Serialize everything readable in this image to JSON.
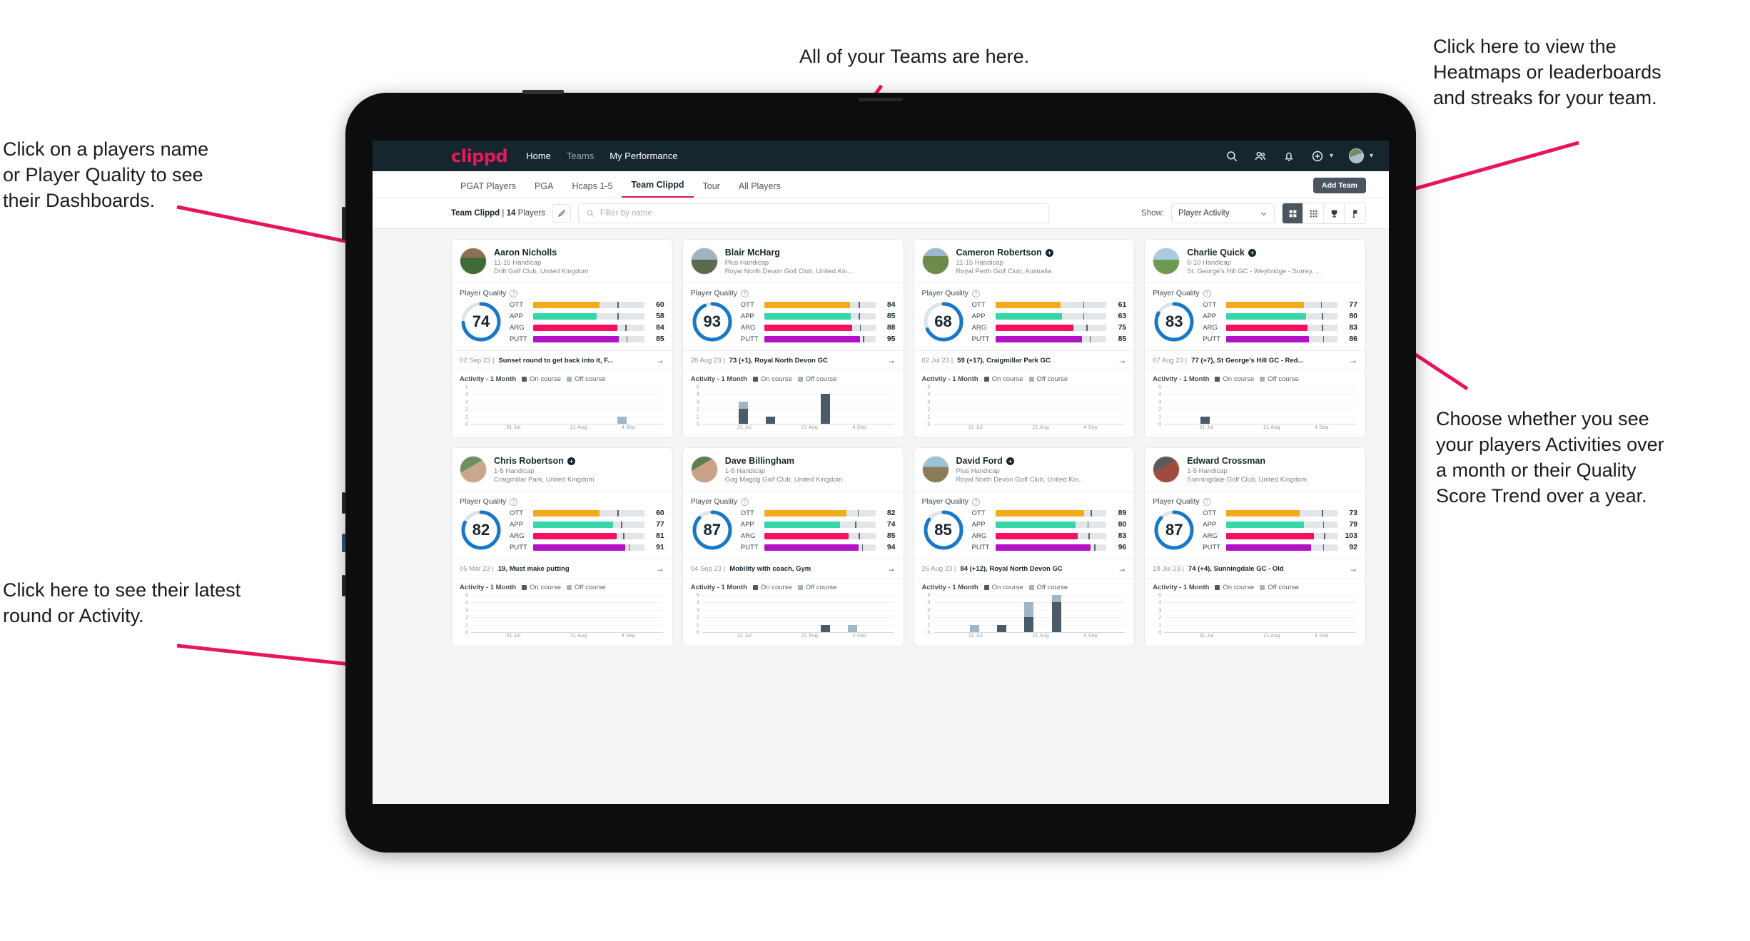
{
  "annotations": [
    {
      "id": "teams",
      "text": "All of your Teams are here."
    },
    {
      "id": "heatmaps",
      "text": "Click here to view the\nHeatmaps or leaderboards\nand streaks for your team."
    },
    {
      "id": "players",
      "text": "Click on a players name\nor Player Quality to see\ntheir Dashboards."
    },
    {
      "id": "showtoggle",
      "text": "Choose whether you see\nyour players Activities over\na month or their Quality\nScore Trend over a year."
    },
    {
      "id": "latest",
      "text": "Click here to see their latest\nround or Activity."
    }
  ],
  "app": {
    "brand": "clippd",
    "nav": [
      {
        "label": "Home",
        "state": "active"
      },
      {
        "label": "Teams",
        "state": "dim"
      },
      {
        "label": "My Performance",
        "state": "active"
      }
    ],
    "header_icons": [
      "search-icon",
      "people-icon",
      "bell-icon",
      "plus-circle-icon",
      "avatar"
    ],
    "tabs": [
      {
        "label": "PGAT Players",
        "active": false
      },
      {
        "label": "PGA",
        "active": false
      },
      {
        "label": "Hcaps 1-5",
        "active": false
      },
      {
        "label": "Team Clippd",
        "active": true
      },
      {
        "label": "Tour",
        "active": false
      },
      {
        "label": "All Players",
        "active": false
      }
    ],
    "add_team_label": "Add Team",
    "filter": {
      "team_name": "Team Clippd",
      "separator": "|",
      "player_count": "14",
      "players_word": "Players",
      "edit_icon": "pencil-icon",
      "search_placeholder": "Filter by name",
      "search_value": "",
      "show_label": "Show:",
      "show_value": "Player Activity",
      "show_options": [
        "Player Activity",
        "Quality Score Trend"
      ],
      "views": [
        {
          "name": "grid-view",
          "icon": "grid-icon",
          "active": true
        },
        {
          "name": "dense-grid-view",
          "icon": "dots-grid-icon",
          "active": false
        },
        {
          "name": "leaderboard-view",
          "icon": "trophy-icon",
          "active": false
        },
        {
          "name": "heatmap-view",
          "icon": "flag-icon",
          "active": false
        }
      ]
    }
  },
  "card_labels": {
    "player_quality": "Player Quality",
    "activity_title": "Activity - 1 Month",
    "legend_on": "On course",
    "legend_off": "Off course",
    "metrics": [
      "OTT",
      "APP",
      "ARG",
      "PUTT"
    ]
  },
  "metric_colors": {
    "OTT": "#f2ab1a",
    "APP": "#35d6a8",
    "ARG": "#f6105f",
    "PUTT": "#b310c8",
    "ring": "#1878c8",
    "ring_track": "#dfe3e7",
    "on_course": "#4a5a66",
    "off_course": "#9fb6c9"
  },
  "chart_data": {
    "type": "bar",
    "title": "Activity - 1 Month",
    "stacked": true,
    "series_names": [
      "On course",
      "Off course"
    ],
    "ylim": [
      0,
      5
    ],
    "yticks": [
      0,
      1,
      2,
      3,
      4,
      5
    ],
    "xticks": [
      "31 Jul",
      "21 Aug",
      "4 Sep"
    ],
    "grid": true,
    "legend_position": "top"
  },
  "players": [
    {
      "name": "Aaron Nicholls",
      "verified": false,
      "handicap": "11-15 Handicap",
      "club": "Drift Golf Club, United Kingdom",
      "quality": 74,
      "metrics": [
        {
          "label": "OTT",
          "value": 60,
          "fill_pct": 60,
          "tick_pct": 76
        },
        {
          "label": "APP",
          "value": 58,
          "fill_pct": 57,
          "tick_pct": 76
        },
        {
          "label": "ARG",
          "value": 84,
          "fill_pct": 76,
          "tick_pct": 83
        },
        {
          "label": "PUTT",
          "value": 85,
          "fill_pct": 77,
          "tick_pct": 84
        }
      ],
      "latest_date": "02 Sep 23",
      "latest_text": "Sunset round to get back into it, F...",
      "activity": {
        "on": [
          0,
          0,
          0,
          0,
          0,
          0,
          0
        ],
        "off": [
          0,
          0,
          0,
          0,
          0,
          1,
          0
        ]
      }
    },
    {
      "name": "Blair McHarg",
      "verified": false,
      "handicap": "Plus Handicap",
      "club": "Royal North Devon Golf Club, United Kin...",
      "quality": 93,
      "metrics": [
        {
          "label": "OTT",
          "value": 84,
          "fill_pct": 77,
          "tick_pct": 85
        },
        {
          "label": "APP",
          "value": 85,
          "fill_pct": 78,
          "tick_pct": 85
        },
        {
          "label": "ARG",
          "value": 88,
          "fill_pct": 79,
          "tick_pct": 86
        },
        {
          "label": "PUTT",
          "value": 95,
          "fill_pct": 86,
          "tick_pct": 89
        }
      ],
      "latest_date": "26 Aug 23",
      "latest_text": "73 (+1), Royal North Devon GC",
      "activity": {
        "on": [
          0,
          2,
          1,
          0,
          4,
          0,
          0
        ],
        "off": [
          0,
          1,
          0,
          0,
          0,
          0,
          0
        ]
      }
    },
    {
      "name": "Cameron Robertson",
      "verified": true,
      "handicap": "11-15 Handicap",
      "club": "Royal Perth Golf Club, Australia",
      "quality": 68,
      "metrics": [
        {
          "label": "OTT",
          "value": 61,
          "fill_pct": 59,
          "tick_pct": 79
        },
        {
          "label": "APP",
          "value": 63,
          "fill_pct": 60,
          "tick_pct": 79
        },
        {
          "label": "ARG",
          "value": 75,
          "fill_pct": 70,
          "tick_pct": 82
        },
        {
          "label": "PUTT",
          "value": 85,
          "fill_pct": 78,
          "tick_pct": 85
        }
      ],
      "latest_date": "02 Jul 23",
      "latest_text": "59 (+17), Craigmillar Park GC",
      "activity": {
        "on": [
          0,
          0,
          0,
          0,
          0,
          0,
          0
        ],
        "off": [
          0,
          0,
          0,
          0,
          0,
          0,
          0
        ]
      }
    },
    {
      "name": "Charlie Quick",
      "verified": true,
      "handicap": "6-10 Handicap",
      "club": "St. George's Hill GC - Weybridge - Surrey, ...",
      "quality": 83,
      "metrics": [
        {
          "label": "OTT",
          "value": 77,
          "fill_pct": 70,
          "tick_pct": 85
        },
        {
          "label": "APP",
          "value": 80,
          "fill_pct": 72,
          "tick_pct": 86
        },
        {
          "label": "ARG",
          "value": 83,
          "fill_pct": 73,
          "tick_pct": 86
        },
        {
          "label": "PUTT",
          "value": 86,
          "fill_pct": 74,
          "tick_pct": 87
        }
      ],
      "latest_date": "07 Aug 23",
      "latest_text": "77 (+7), St George's Hill GC - Red...",
      "activity": {
        "on": [
          0,
          1,
          0,
          0,
          0,
          0,
          0
        ],
        "off": [
          0,
          0,
          0,
          0,
          0,
          0,
          0
        ]
      }
    },
    {
      "name": "Chris Robertson",
      "verified": true,
      "handicap": "1-5 Handicap",
      "club": "Craigmillar Park, United Kingdom",
      "quality": 82,
      "metrics": [
        {
          "label": "OTT",
          "value": 60,
          "fill_pct": 60,
          "tick_pct": 76
        },
        {
          "label": "APP",
          "value": 77,
          "fill_pct": 72,
          "tick_pct": 79
        },
        {
          "label": "ARG",
          "value": 81,
          "fill_pct": 75,
          "tick_pct": 81
        },
        {
          "label": "PUTT",
          "value": 91,
          "fill_pct": 83,
          "tick_pct": 86
        }
      ],
      "latest_date": "05 Mar 23",
      "latest_text": "19, Must make putting",
      "activity": {
        "on": [
          0,
          0,
          0,
          0,
          0,
          0,
          0
        ],
        "off": [
          0,
          0,
          0,
          0,
          0,
          0,
          0
        ]
      }
    },
    {
      "name": "Dave Billingham",
      "verified": false,
      "handicap": "1-5 Handicap",
      "club": "Gog Magog Golf Club, United Kingdom",
      "quality": 87,
      "metrics": [
        {
          "label": "OTT",
          "value": 82,
          "fill_pct": 74,
          "tick_pct": 84
        },
        {
          "label": "APP",
          "value": 74,
          "fill_pct": 68,
          "tick_pct": 82
        },
        {
          "label": "ARG",
          "value": 85,
          "fill_pct": 76,
          "tick_pct": 85
        },
        {
          "label": "PUTT",
          "value": 94,
          "fill_pct": 85,
          "tick_pct": 88
        }
      ],
      "latest_date": "04 Sep 23",
      "latest_text": "Mobility with coach, Gym",
      "activity": {
        "on": [
          0,
          0,
          0,
          0,
          1,
          0,
          0
        ],
        "off": [
          0,
          0,
          0,
          0,
          0,
          1,
          0
        ]
      }
    },
    {
      "name": "David Ford",
      "verified": true,
      "handicap": "Plus Handicap",
      "club": "Royal North Devon Golf Club, United Kin...",
      "quality": 85,
      "metrics": [
        {
          "label": "OTT",
          "value": 89,
          "fill_pct": 80,
          "tick_pct": 86
        },
        {
          "label": "APP",
          "value": 80,
          "fill_pct": 72,
          "tick_pct": 83
        },
        {
          "label": "ARG",
          "value": 83,
          "fill_pct": 74,
          "tick_pct": 84
        },
        {
          "label": "PUTT",
          "value": 96,
          "fill_pct": 86,
          "tick_pct": 89
        }
      ],
      "latest_date": "26 Aug 23",
      "latest_text": "84 (+12), Royal North Devon GC",
      "activity": {
        "on": [
          0,
          0,
          1,
          2,
          4,
          0,
          0
        ],
        "off": [
          0,
          1,
          0,
          2,
          1,
          0,
          0
        ]
      }
    },
    {
      "name": "Edward Crossman",
      "verified": false,
      "handicap": "1-5 Handicap",
      "club": "Sunningdale Golf Club, United Kingdom",
      "quality": 87,
      "metrics": [
        {
          "label": "OTT",
          "value": 73,
          "fill_pct": 66,
          "tick_pct": 86
        },
        {
          "label": "APP",
          "value": 79,
          "fill_pct": 70,
          "tick_pct": 87
        },
        {
          "label": "ARG",
          "value": 103,
          "fill_pct": 79,
          "tick_pct": 88
        },
        {
          "label": "PUTT",
          "value": 92,
          "fill_pct": 76,
          "tick_pct": 87
        }
      ],
      "latest_date": "18 Jul 23",
      "latest_text": "74 (+4), Sunningdale GC - Old",
      "activity": {
        "on": [
          0,
          0,
          0,
          0,
          0,
          0,
          0
        ],
        "off": [
          0,
          0,
          0,
          0,
          0,
          0,
          0
        ]
      }
    }
  ]
}
